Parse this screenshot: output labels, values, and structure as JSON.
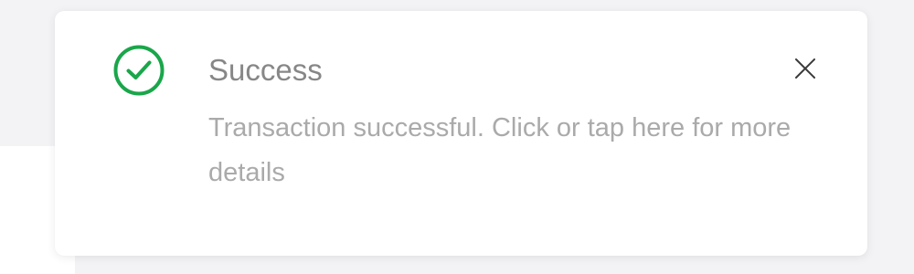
{
  "toast": {
    "status": "success",
    "title": "Success",
    "message": "Transaction successful. Click or tap here for more details",
    "close_label": "X"
  },
  "icons": {
    "status_icon": "check-circle-icon",
    "close_icon": "close-icon"
  },
  "colors": {
    "success_green": "#1aa64a",
    "title_gray": "#878787",
    "message_gray": "#aaaaaa",
    "background": "#f3f3f5",
    "card": "#ffffff"
  }
}
